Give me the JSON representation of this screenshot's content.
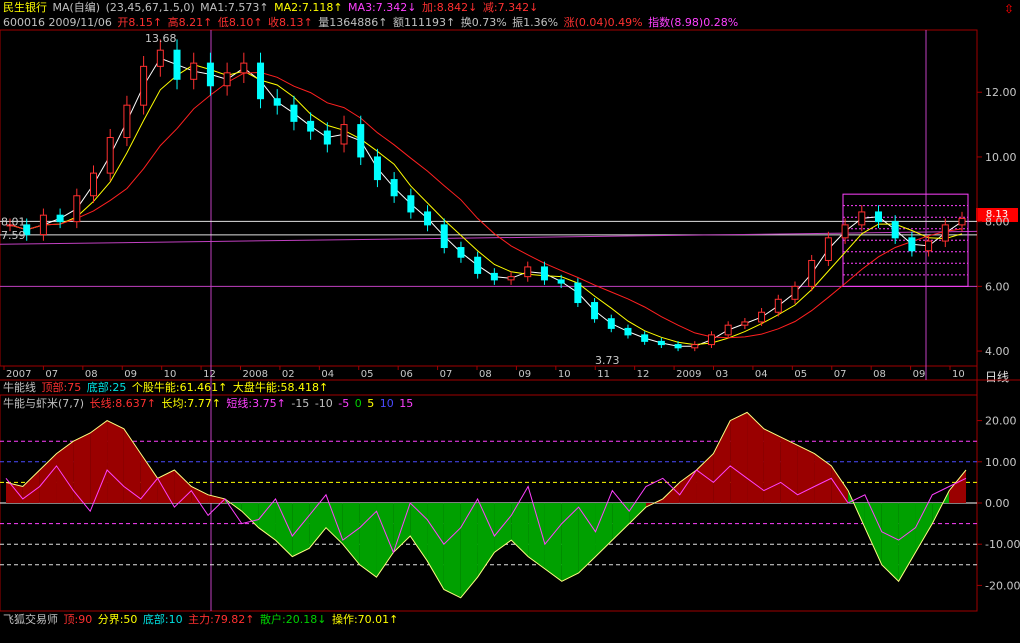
{
  "header": {
    "stock_name": "民生银行",
    "ma_label": "MA(自编)",
    "ma_params": "(23,45,67,1.5,0)",
    "ma1": "MA1:7.573↑",
    "ma2": "MA2:7.118↑",
    "ma3": "MA3:7.342↓",
    "add": "加:8.842↓",
    "sub": "减:7.342↓"
  },
  "info": {
    "code_date": "600016 2009/11/06",
    "open": "开8.15↑",
    "high": "高8.21↑",
    "low": "低8.10↑",
    "close": "收8.13↑",
    "volume": "量1364886↑",
    "amount": "额111193↑",
    "turnover": "换0.73%",
    "amplitude": "振1.36%",
    "change": "涨(0.04)0.49%",
    "index": "指数(8.98)0.28%"
  },
  "indicator1": {
    "name": "牛能线",
    "top": "顶部:75",
    "bottom": "底部:25",
    "stock": "个股牛能:61.461↑",
    "market": "大盘牛能:58.418↑"
  },
  "indicator2": {
    "name": "牛能与虾米(7,7)",
    "long": "长线:8.637↑",
    "long_avg": "长均:7.77↑",
    "short": "短线:3.75↑",
    "lv1": "-15",
    "lv2": "-10",
    "lv3": "-5",
    "lv4": "0",
    "lv5": "5",
    "lv6": "10",
    "lv7": "15"
  },
  "footer": {
    "name": "飞狐交易师",
    "top": "顶:90",
    "boundary": "分界:50",
    "bottom": "底部:10",
    "main": "主力:79.82↑",
    "retail": "散户:20.18↓",
    "operate": "操作:70.01↑"
  },
  "day_label": "日线",
  "price_badge": "8.13",
  "colors": {
    "up": "#ff3030",
    "down": "#00ffff",
    "ma1": "#ffffff",
    "ma2": "#ffff00",
    "ma3": "#ff2020",
    "osc_pos": "#9a0000",
    "osc_neg": "#00a000",
    "short": "#ff40ff"
  },
  "chart_data": [
    {
      "type": "candlestick",
      "ylim": [
        3.6,
        13.8
      ],
      "yticks": [
        "4.00",
        "6.00",
        "8.00",
        "10.00",
        "12.00"
      ],
      "ytick_values": [
        4,
        6,
        8,
        10,
        12
      ],
      "x_labels": [
        "2007",
        "07",
        "08",
        "09",
        "10",
        "12",
        "2008",
        "02",
        "04",
        "05",
        "06",
        "07",
        "08",
        "09",
        "10",
        "11",
        "12",
        "2009",
        "03",
        "04",
        "05",
        "07",
        "08",
        "09",
        "10"
      ],
      "annotations": [
        {
          "text": "13.68",
          "x": "2007-09",
          "value": 13.68
        },
        {
          "text": "3.73",
          "x": "2008-11",
          "value": 3.73
        },
        {
          "text": "8.01",
          "value": 8.01
        },
        {
          "text": "7.59",
          "value": 7.59
        }
      ],
      "series_close": [
        7.9,
        7.6,
        8.2,
        8.0,
        8.8,
        9.5,
        10.6,
        11.6,
        12.8,
        13.3,
        12.4,
        12.9,
        12.2,
        12.6,
        12.9,
        11.8,
        11.6,
        11.1,
        10.8,
        10.4,
        11.0,
        10.0,
        9.3,
        8.8,
        8.3,
        7.9,
        7.2,
        6.9,
        6.4,
        6.2,
        6.3,
        6.6,
        6.2,
        6.1,
        5.5,
        5.0,
        4.7,
        4.5,
        4.3,
        4.2,
        4.1,
        4.2,
        4.5,
        4.8,
        4.9,
        5.2,
        5.6,
        6.0,
        6.8,
        7.5,
        7.9,
        8.3,
        8.0,
        7.5,
        7.1,
        7.4,
        7.9,
        8.1
      ]
    },
    {
      "type": "oscillator",
      "ylim": [
        -25,
        25
      ],
      "yticks": [
        "20.00",
        "10.00",
        "0.00",
        "-10.00",
        "-20.00"
      ],
      "ytick_values": [
        20,
        10,
        0,
        -10,
        -20
      ],
      "levels": [
        -15,
        -10,
        -5,
        0,
        5,
        10,
        15
      ],
      "long_line": [
        5,
        4,
        8,
        12,
        15,
        17,
        20,
        18,
        12,
        6,
        8,
        4,
        2,
        1,
        -2,
        -6,
        -9,
        -13,
        -11,
        -6,
        -10,
        -15,
        -18,
        -12,
        -8,
        -14,
        -21,
        -23,
        -18,
        -12,
        -9,
        -13,
        -16,
        -19,
        -17,
        -13,
        -9,
        -5,
        -1,
        1,
        5,
        8,
        12,
        20,
        22,
        18,
        16,
        14,
        12,
        9,
        3,
        -6,
        -15,
        -19,
        -12,
        -5,
        3,
        8
      ],
      "short_line": [
        6,
        1,
        4,
        9,
        3,
        -2,
        8,
        4,
        1,
        6,
        -1,
        3,
        -3,
        1,
        -5,
        -4,
        1,
        -8,
        -3,
        2,
        -9,
        -6,
        -2,
        -12,
        0,
        -4,
        -10,
        -6,
        1,
        -8,
        -3,
        4,
        -10,
        -5,
        -1,
        -7,
        3,
        -2,
        4,
        6,
        2,
        8,
        5,
        9,
        6,
        3,
        5,
        2,
        4,
        6,
        0,
        2,
        -7,
        -9,
        -6,
        2,
        4,
        6
      ]
    }
  ]
}
